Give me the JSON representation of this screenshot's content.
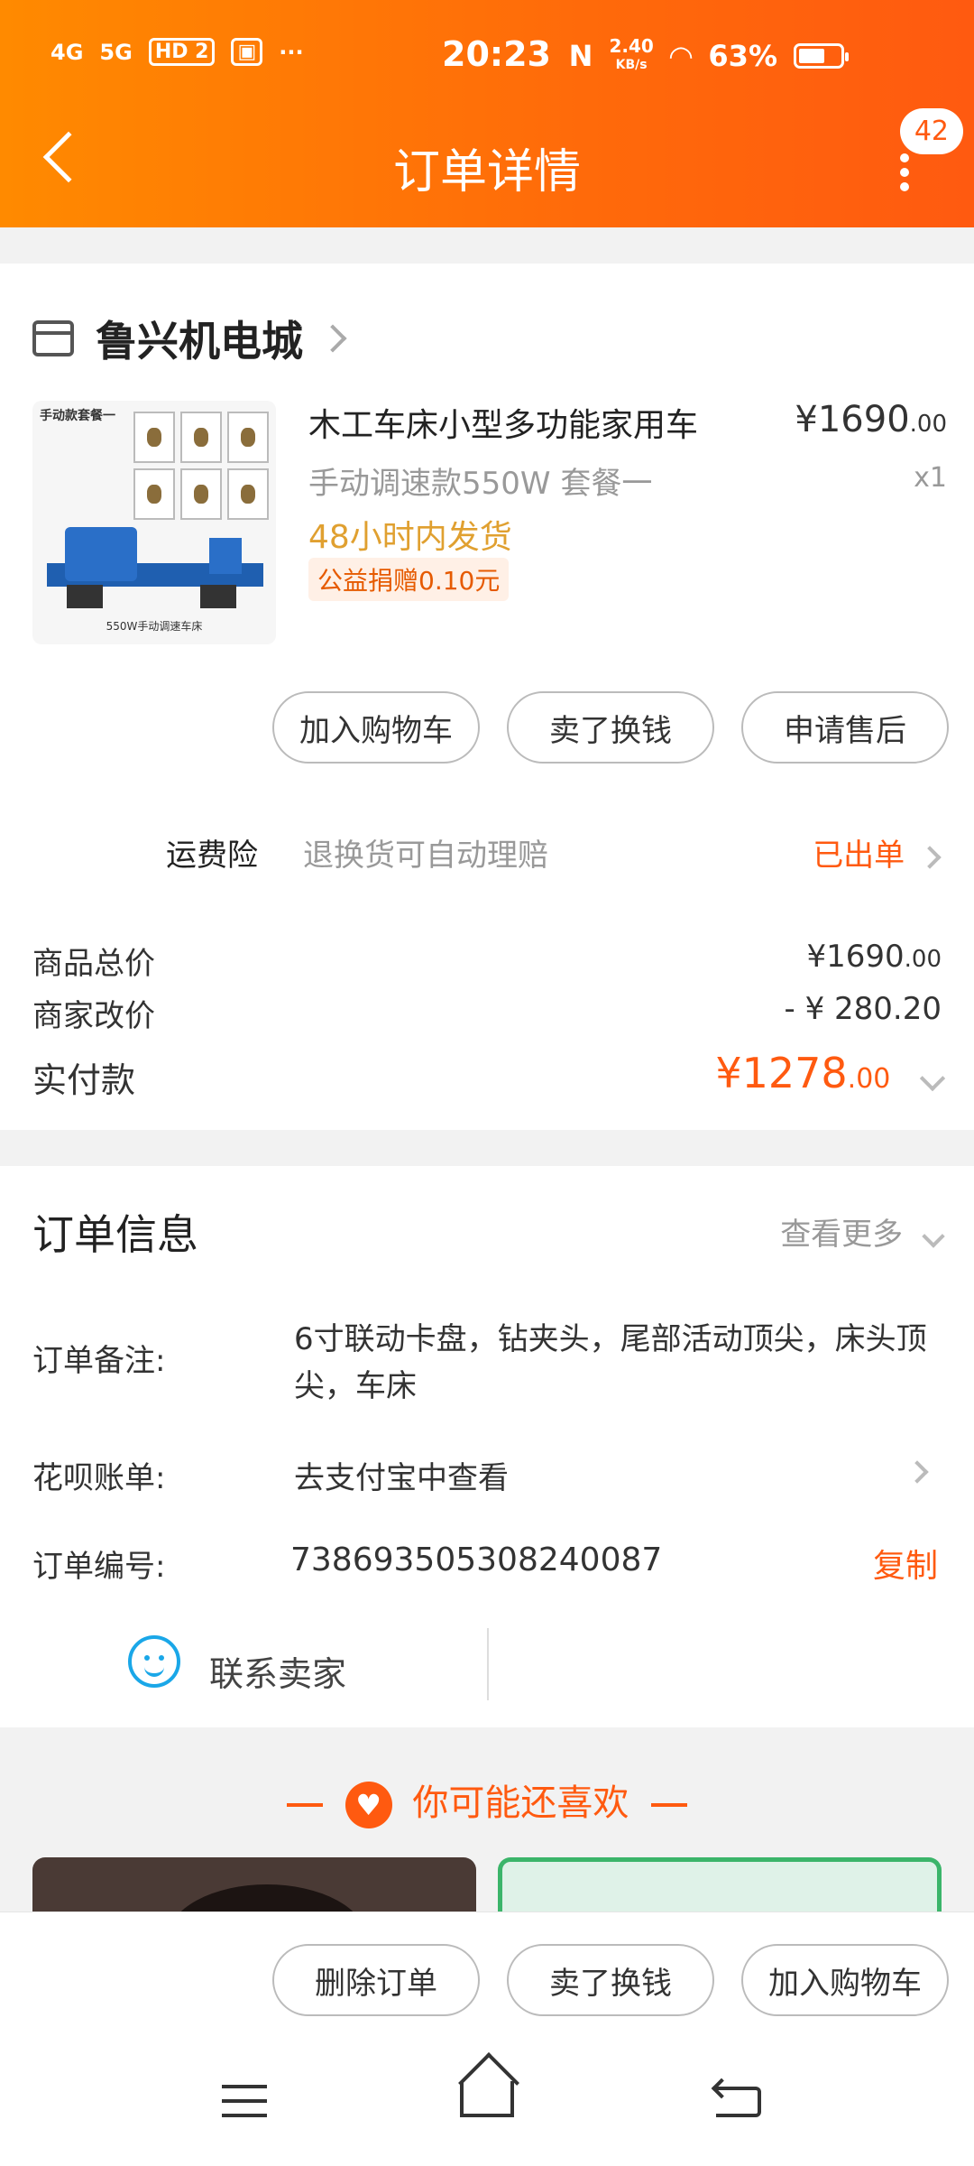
{
  "status": {
    "left_icons": [
      "4G",
      "5G",
      "HD 2"
    ],
    "more": "···",
    "time": "20:23",
    "nfc": "N",
    "speed_value": "2.40",
    "speed_unit": "KB/s",
    "battery": "63%"
  },
  "nav": {
    "title": "订单详情",
    "badge": "42"
  },
  "shop": {
    "name": "鲁兴机电城"
  },
  "product": {
    "title": "木工车床小型多功能家用车",
    "price_main": "¥1690",
    "price_decimal": ".00",
    "sku": "手动调速款550W 套餐一",
    "qty": "x1",
    "ship": "48小时内发货",
    "charity": "公益捐赠0.10元",
    "image_header": "手动款套餐一",
    "image_caption": "550W手动调速车床"
  },
  "actions": {
    "add_cart": "加入购物车",
    "sell": "卖了换钱",
    "after_sale": "申请售后"
  },
  "insurance": {
    "label": "运费险",
    "desc": "退换货可自动理赔",
    "status": "已出单"
  },
  "summary": {
    "total_label": "商品总价",
    "total_main": "¥1690",
    "total_decimal": ".00",
    "adjust_label": "商家改价",
    "adjust_value": "- ¥ 280.20",
    "paid_label": "实付款",
    "paid_main": "¥1278",
    "paid_decimal": ".00"
  },
  "order_info": {
    "heading": "订单信息",
    "more": "查看更多",
    "note_label": "订单备注:",
    "note_value": "6寸联动卡盘，钻夹头，尾部活动顶尖，床头顶尖，车床",
    "huabei_label": "花呗账单:",
    "huabei_value": "去支付宝中查看",
    "no_label": "订单编号:",
    "no_value": "738693505308240087",
    "copy": "复制",
    "contact": "联系卖家"
  },
  "recommend": {
    "title": "你可能还喜欢"
  },
  "bottom": {
    "delete": "删除订单",
    "sell": "卖了换钱",
    "add_cart": "加入购物车"
  },
  "colors": {
    "accent": "#ff5a10",
    "header_start": "#ff8a00",
    "ship": "#e0a030",
    "contact": "#1aa7e8"
  }
}
